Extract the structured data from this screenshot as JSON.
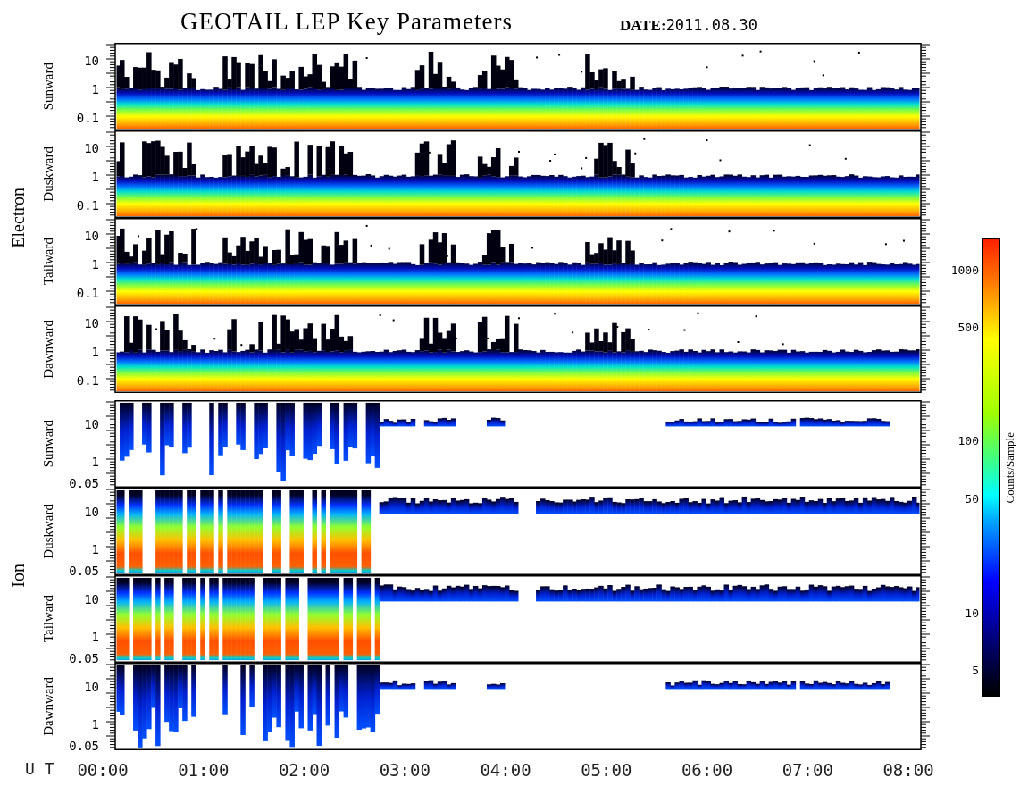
{
  "title": "GEOTAIL LEP Key Parameters",
  "date": {
    "label": "DATE:",
    "value": "2011.08.30"
  },
  "groups": [
    {
      "label": "Electron",
      "kind": "electron",
      "panels": [
        {
          "label": "Sunward",
          "yticks": [
            "10",
            "1",
            "0.1"
          ]
        },
        {
          "label": "Duskward",
          "yticks": [
            "10",
            "1",
            "0.1"
          ]
        },
        {
          "label": "Tailward",
          "yticks": [
            "10",
            "1",
            "0.1"
          ]
        },
        {
          "label": "Dawnward",
          "yticks": [
            "10",
            "1",
            "0.1"
          ]
        }
      ]
    },
    {
      "label": "Ion",
      "kind": "ion",
      "panels": [
        {
          "label": "Sunward",
          "yticks": [
            "10",
            "1",
            "0.05"
          ]
        },
        {
          "label": "Duskward",
          "yticks": [
            "10",
            "1",
            "0.05"
          ]
        },
        {
          "label": "Tailward",
          "yticks": [
            "10",
            "1",
            "0.05"
          ]
        },
        {
          "label": "Dawnward",
          "yticks": [
            "10",
            "1",
            "0.05"
          ]
        }
      ]
    }
  ],
  "x_axis": {
    "label": "U T",
    "ticks": [
      "00:00",
      "01:00",
      "02:00",
      "03:00",
      "04:00",
      "05:00",
      "06:00",
      "07:00",
      "08:00"
    ]
  },
  "colorbar": {
    "label": "Counts/Sample",
    "ticks": [
      "1000",
      "500",
      "100",
      "50",
      "10",
      "5"
    ]
  }
}
